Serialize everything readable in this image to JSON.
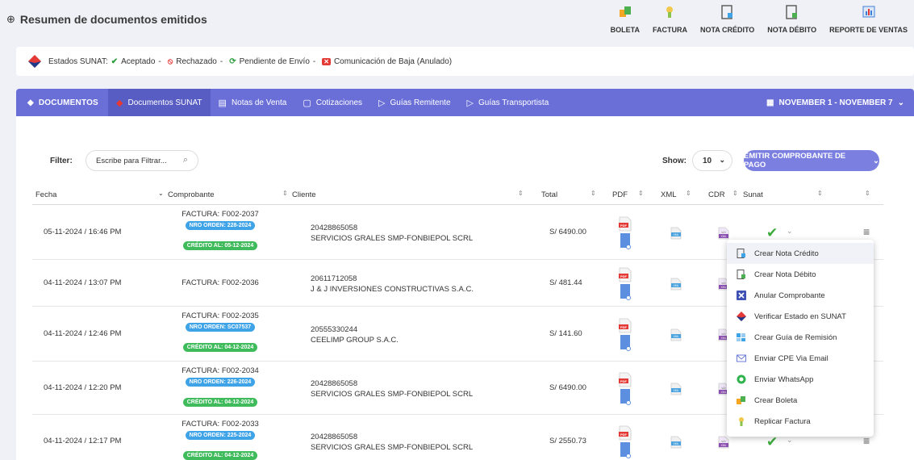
{
  "header": {
    "title": "Resumen de documentos emitidos",
    "actions": [
      {
        "label": "BOLETA",
        "icon": "boleta-icon"
      },
      {
        "label": "FACTURA",
        "icon": "factura-icon"
      },
      {
        "label": "NOTA CRÉDITO",
        "icon": "nota-credito-icon"
      },
      {
        "label": "NOTA DÉBITO",
        "icon": "nota-debito-icon"
      },
      {
        "label": "REPORTE DE VENTAS",
        "icon": "report-icon"
      }
    ]
  },
  "estados": {
    "prefix": "Estados SUNAT:",
    "aceptado": "Aceptado",
    "rechazado": "Rechazado",
    "pendiente": "Pendiente de Envío",
    "baja": "Comunicación de Baja (Anulado)",
    "sep": "-"
  },
  "nav": {
    "brand": "DOCUMENTOS",
    "tabs": [
      "Documentos SUNAT",
      "Notas de Venta",
      "Cotizaciones",
      "Guías Remitente",
      "Guías Transportista"
    ],
    "date_range": "NOVEMBER 1 - NOVEMBER 7"
  },
  "toolbar": {
    "filter_label": "Filter:",
    "search_placeholder": "Escribe para Filtrar...",
    "show_label": "Show:",
    "show_value": "10",
    "emit_button": "EMITIR COMPROBANTE DE PAGO"
  },
  "table": {
    "headers": [
      "Fecha",
      "Comprobante",
      "Cliente",
      "Total",
      "PDF",
      "XML",
      "CDR",
      "Sunat"
    ],
    "rows": [
      {
        "fecha": "05-11-2024 / 16:46 PM",
        "comprobante": "FACTURA: F002-2037",
        "orden": "NRO ORDEN: 228-2024",
        "credito": "CRÉDITO AL: 05-12-2024",
        "ruc": "20428865058",
        "cliente": "SERVICIOS GRALES SMP-FONBIEPOL SCRL",
        "total": "S/ 6490.00"
      },
      {
        "fecha": "04-11-2024 / 13:07 PM",
        "comprobante": "FACTURA: F002-2036",
        "orden": "",
        "credito": "",
        "ruc": "20611712058",
        "cliente": "J & J INVERSIONES CONSTRUCTIVAS S.A.C.",
        "total": "S/ 481.44"
      },
      {
        "fecha": "04-11-2024 / 12:46 PM",
        "comprobante": "FACTURA: F002-2035",
        "orden": "NRO ORDEN: SC07537",
        "credito": "CRÉDITO AL: 04-12-2024",
        "ruc": "20555330244",
        "cliente": "CEELIMP GROUP S.A.C.",
        "total": "S/ 141.60"
      },
      {
        "fecha": "04-11-2024 / 12:20 PM",
        "comprobante": "FACTURA: F002-2034",
        "orden": "NRO ORDEN: 226-2024",
        "credito": "CRÉDITO AL: 04-12-2024",
        "ruc": "20428865058",
        "cliente": "SERVICIOS GRALES SMP-FONBIEPOL SCRL",
        "total": "S/ 6490.00"
      },
      {
        "fecha": "04-11-2024 / 12:17 PM",
        "comprobante": "FACTURA: F002-2033",
        "orden": "NRO ORDEN: 225-2024",
        "credito": "CRÉDITO AL: 04-12-2024",
        "ruc": "20428865058",
        "cliente": "SERVICIOS GRALES SMP-FONBIEPOL SCRL",
        "total": "S/ 2550.73"
      }
    ],
    "pdf_label": "PDF",
    "xml_label": "XML",
    "cdr_label": "</>",
    "cdr_sub": "XML"
  },
  "menu": {
    "items": [
      {
        "label": "Crear Nota Crédito",
        "icon": "nota-credito-icon"
      },
      {
        "label": "Crear Nota Débito",
        "icon": "nota-debito-icon"
      },
      {
        "label": "Anular Comprobante",
        "icon": "anular-icon"
      },
      {
        "label": "Verificar Estado en SUNAT",
        "icon": "sunat-icon"
      },
      {
        "label": "Crear Guía de Remisión",
        "icon": "guia-icon"
      },
      {
        "label": "Enviar CPE Via Email",
        "icon": "email-icon"
      },
      {
        "label": "Enviar WhatsApp",
        "icon": "whatsapp-icon"
      },
      {
        "label": "Crear Boleta",
        "icon": "boleta-icon"
      },
      {
        "label": "Replicar Factura",
        "icon": "factura-icon"
      }
    ]
  },
  "colors": {
    "nav": "#6a6fd8",
    "accent": "#7b7fe0",
    "success": "#3fbb5b",
    "info": "#3fa3e8",
    "danger": "#e53935"
  }
}
